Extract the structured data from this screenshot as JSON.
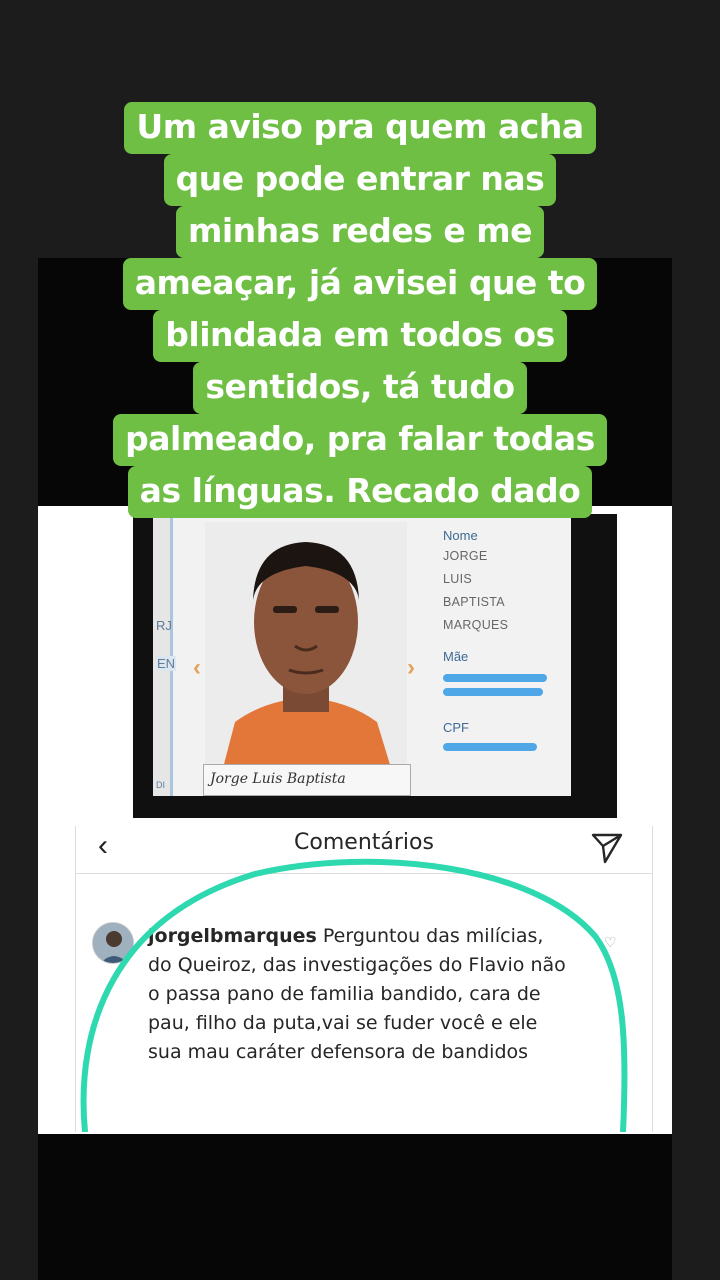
{
  "caption": {
    "lines": [
      "Um aviso pra quem acha",
      "que pode entrar nas",
      "minhas redes e me",
      "ameaçar,  já avisei que to",
      "blindada em todos os",
      "sentidos, tá tudo",
      "palmeado, pra falar todas",
      "as línguas.  Recado dado"
    ],
    "bg_color": "#6fbf45"
  },
  "id_card": {
    "left_labels": [
      "RJ",
      "EN",
      "DI"
    ],
    "signature": "Jorge Luis Baptista",
    "name_label": "Nome",
    "name_lines": [
      "JORGE",
      "LUIS",
      "BAPTISTA",
      "MARQUES"
    ],
    "mother_label": "Mãe",
    "cpf_label": "CPF",
    "redaction_color": "#4fa7e8"
  },
  "comments": {
    "back_icon": "chevron-left-icon",
    "title": "Comentários",
    "send_icon": "paper-plane-icon",
    "comment": {
      "username": "jorgelbmarques",
      "text": " Perguntou das milícias, do Queiroz, das investigações do Flavio não o passa pano de familia bandido, cara de pau, filho da puta,vai se fuder você e ele sua mau caráter defensora de bandidos",
      "like_icon": "heart-outline-icon"
    },
    "highlight_color": "#2fd9b0"
  }
}
